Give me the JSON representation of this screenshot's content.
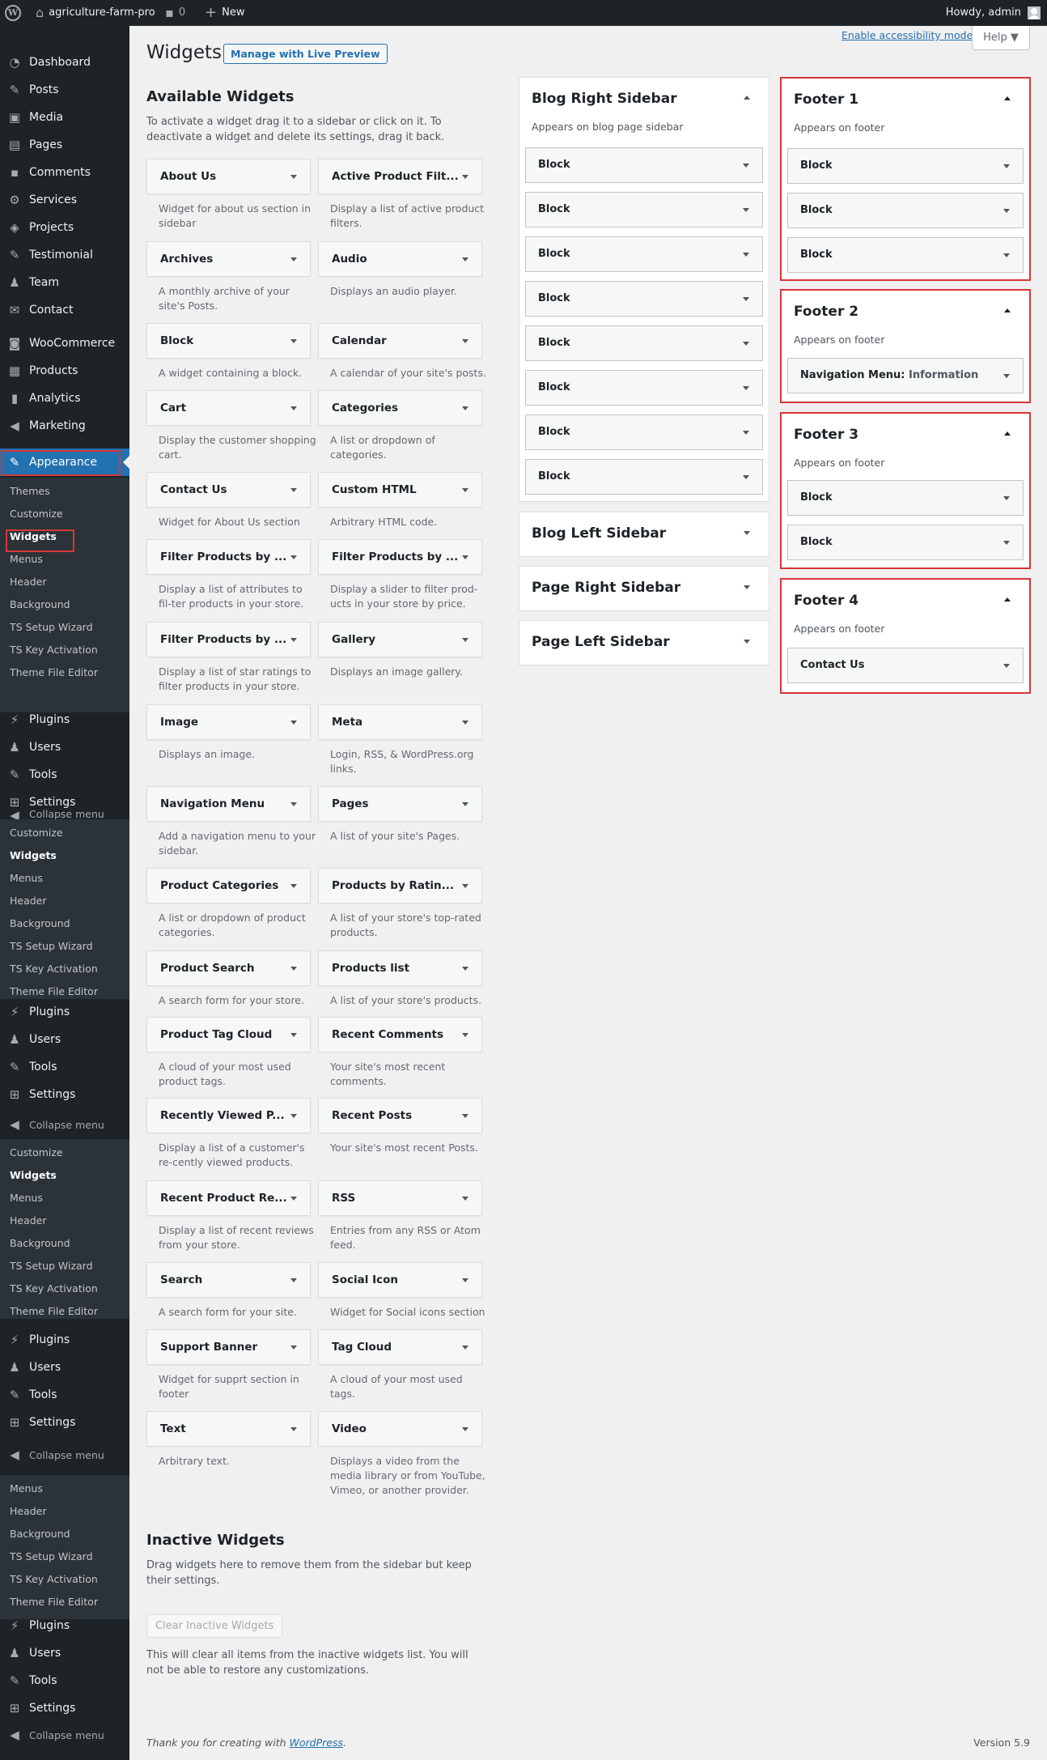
{
  "admin_bar": {
    "site_name": "agriculture-farm-pro",
    "comments_count": "0",
    "new_label": "New",
    "greeting": "Howdy, admin"
  },
  "menu": {
    "main": [
      "Dashboard",
      "Posts",
      "Media",
      "Pages",
      "Comments",
      "Services",
      "Projects",
      "Testimonial",
      "Team",
      "Contact",
      "WooCommerce",
      "Products",
      "Analytics",
      "Marketing",
      "Appearance"
    ],
    "appearance_sub": [
      "Themes",
      "Customize",
      "Widgets",
      "Menus",
      "Header",
      "Background",
      "TS Setup Wizard",
      "TS Key Activation",
      "Theme File Editor"
    ],
    "tools_group": [
      "Plugins",
      "Users",
      "Tools",
      "Settings"
    ],
    "collapse": "Collapse menu",
    "collapse_clipped": "Collapse menu"
  },
  "page": {
    "title": "Widgets",
    "live_preview": "Manage with Live Preview",
    "accessibility_link": "Enable accessibility mode",
    "help": "Help ▼"
  },
  "available": {
    "title": "Available Widgets",
    "desc": "To activate a widget drag it to a sidebar or click on it. To deactivate a widget and delete its settings, drag it back.",
    "widgets": [
      {
        "t": "About Us",
        "d": "Widget for about us section in sidebar"
      },
      {
        "t": "Active Product Filt...",
        "d": "Display a list of active product filters."
      },
      {
        "t": "Archives",
        "d": "A monthly archive of your site's Posts."
      },
      {
        "t": "Audio",
        "d": "Displays an audio player."
      },
      {
        "t": "Block",
        "d": "A widget containing a block."
      },
      {
        "t": "Calendar",
        "d": "A calendar of your site's posts."
      },
      {
        "t": "Cart",
        "d": "Display the customer shopping cart."
      },
      {
        "t": "Categories",
        "d": "A list or dropdown of categories."
      },
      {
        "t": "Contact Us",
        "d": "Widget for About Us section"
      },
      {
        "t": "Custom HTML",
        "d": "Arbitrary HTML code."
      },
      {
        "t": "Filter Products by ...",
        "d": "Display a list of attributes to fil-ter products in your store."
      },
      {
        "t": "Filter Products by ...",
        "d": "Display a slider to filter prod-ucts in your store by price."
      },
      {
        "t": "Filter Products by ...",
        "d": "Display a list of star ratings to filter products in your store."
      },
      {
        "t": "Gallery",
        "d": "Displays an image gallery."
      },
      {
        "t": "Image",
        "d": "Displays an image."
      },
      {
        "t": "Meta",
        "d": "Login, RSS, & WordPress.org links."
      },
      {
        "t": "Navigation Menu",
        "d": "Add a navigation menu to your sidebar."
      },
      {
        "t": "Pages",
        "d": "A list of your site's Pages."
      },
      {
        "t": "Product Categories",
        "d": "A list or dropdown of product categories."
      },
      {
        "t": "Products by Ratin...",
        "d": "A list of your store's top-rated products."
      },
      {
        "t": "Product Search",
        "d": "A search form for your store."
      },
      {
        "t": "Products list",
        "d": "A list of your store's products."
      },
      {
        "t": "Product Tag Cloud",
        "d": "A cloud of your most used product tags."
      },
      {
        "t": "Recent Comments",
        "d": "Your site's most recent comments."
      },
      {
        "t": "Recently Viewed P...",
        "d": "Display a list of a customer's re-cently viewed products."
      },
      {
        "t": "Recent Posts",
        "d": "Your site's most recent Posts."
      },
      {
        "t": "Recent Product Re...",
        "d": "Display a list of recent reviews from your store."
      },
      {
        "t": "RSS",
        "d": "Entries from any RSS or Atom feed."
      },
      {
        "t": "Search",
        "d": "A search form for your site."
      },
      {
        "t": "Social Icon",
        "d": "Widget for Social icons section"
      },
      {
        "t": "Support Banner",
        "d": "Widget for supprt section in footer"
      },
      {
        "t": "Tag Cloud",
        "d": "A cloud of your most used tags."
      },
      {
        "t": "Text",
        "d": "Arbitrary text."
      },
      {
        "t": "Video",
        "d": "Displays a video from the media library or from YouTube, Vimeo, or another provider."
      }
    ]
  },
  "inactive": {
    "title": "Inactive Widgets",
    "desc": "Drag widgets here to remove them from the sidebar but keep their settings.",
    "clear": "Clear Inactive Widgets",
    "note": "This will clear all items from the inactive widgets list. You will not be able to restore any customizations."
  },
  "sidebars": {
    "blog_right": {
      "title": "Blog Right Sidebar",
      "desc": "Appears on blog page sidebar",
      "widgets": [
        "Block",
        "Block",
        "Block",
        "Block",
        "Block",
        "Block",
        "Block",
        "Block"
      ]
    },
    "blog_left": {
      "title": "Blog Left Sidebar"
    },
    "page_right": {
      "title": "Page Right Sidebar"
    },
    "page_left": {
      "title": "Page Left Sidebar"
    },
    "footer1": {
      "title": "Footer 1",
      "desc": "Appears on footer",
      "widgets": [
        "Block",
        "Block",
        "Block"
      ]
    },
    "footer2": {
      "title": "Footer 2",
      "desc": "Appears on footer",
      "widget_main": "Navigation Menu:",
      "widget_sub": "Information"
    },
    "footer3": {
      "title": "Footer 3",
      "desc": "Appears on footer",
      "widgets": [
        "Block",
        "Block"
      ]
    },
    "footer4": {
      "title": "Footer 4",
      "desc": "Appears on footer",
      "widgets": [
        "Contact Us"
      ]
    }
  },
  "footer": {
    "thanks": "Thank you for creating with",
    "wp_link": "WordPress",
    "version": "Version 5.9"
  },
  "colors": {
    "admin_dark": "#1d2327",
    "submenu": "#2c3338",
    "accent": "#2271b1",
    "highlight": "#d63638"
  }
}
